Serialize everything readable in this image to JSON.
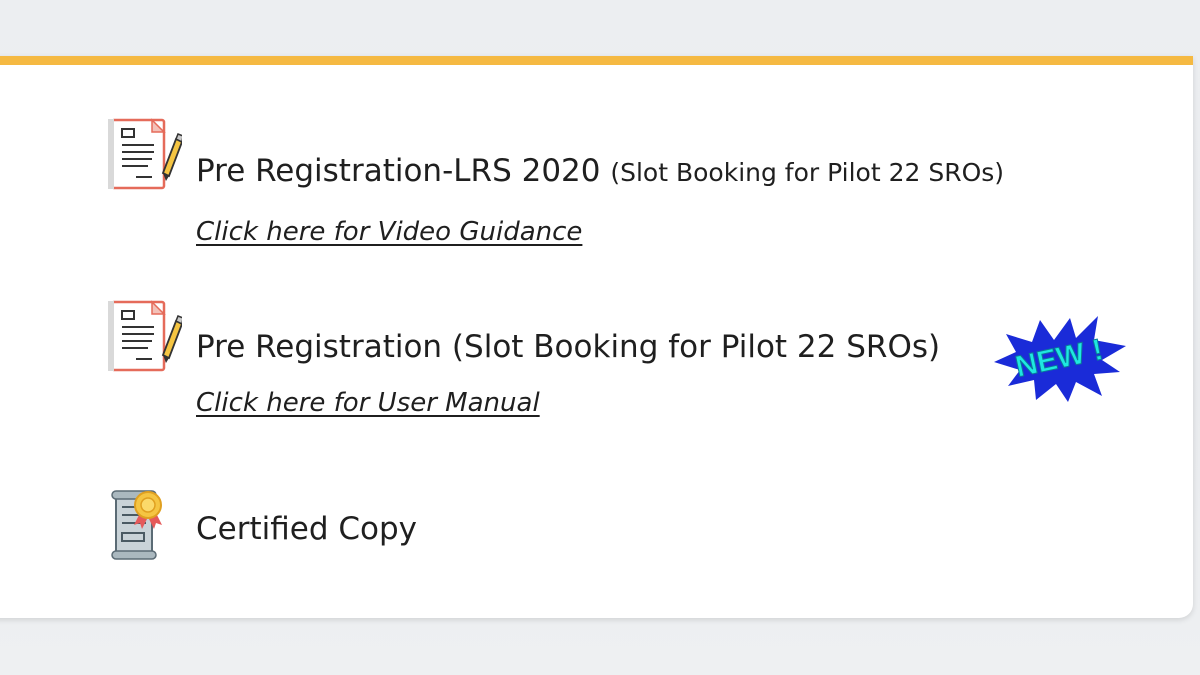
{
  "services": [
    {
      "title": "Pre Registration-LRS 2020",
      "subtitle": "(Slot Booking for Pilot 22 SROs)",
      "link": "Click here for Video Guidance",
      "icon": "registration-form-icon"
    },
    {
      "title": "Pre Registration (Slot Booking for Pilot 22 SROs)",
      "link": "Click here for User Manual",
      "badge": "NEW !",
      "icon": "registration-form-icon"
    },
    {
      "title": "Certified Copy",
      "icon": "certified-scroll-icon"
    }
  ],
  "colors": {
    "accent_bar": "#f5b942",
    "badge_fill": "#1a2bd8",
    "badge_text": "#1ee8e0"
  }
}
